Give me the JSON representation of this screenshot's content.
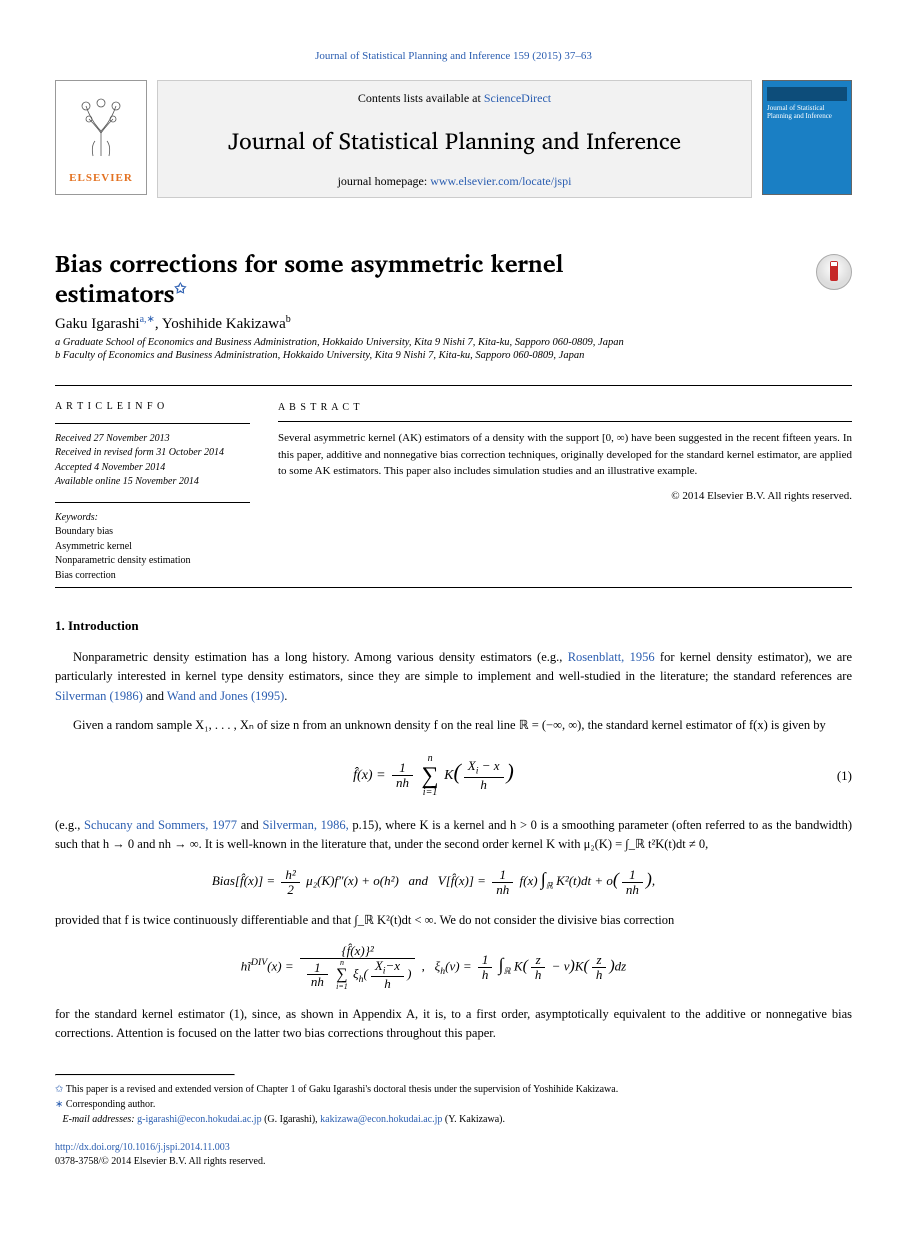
{
  "citation": "Journal of Statistical Planning and Inference 159 (2015) 37–63",
  "masthead": {
    "contents_prefix": "Contents lists available at ",
    "contents_link": "ScienceDirect",
    "journal_name": "Journal of Statistical Planning and Inference",
    "homepage_prefix": "journal homepage: ",
    "homepage_link": "www.elsevier.com/locate/jspi",
    "elsevier": "ELSEVIER",
    "cover_title": "Journal of Statistical Planning and Inference"
  },
  "article": {
    "title_line1": "Bias corrections for some asymmetric kernel",
    "title_line2": "estimators",
    "fnmark": "✩",
    "authors_a": "Gaku Igarashi",
    "authors_b": "Yoshihide Kakizawa",
    "sup_a": "a,",
    "sup_star": "∗",
    "sup_b": "b",
    "comma": ", ",
    "affiliation_a": "a Graduate School of Economics and Business Administration, Hokkaido University, Kita 9 Nishi 7, Kita-ku, Sapporo 060-0809, Japan",
    "affiliation_b": "b Faculty of Economics and Business Administration, Hokkaido University, Kita 9 Nishi 7, Kita-ku, Sapporo 060-0809, Japan"
  },
  "info": {
    "heading": "A R T I C L E   I N F O",
    "received": "Received 27 November 2013",
    "revised": "Received in revised form 31 October 2014",
    "accepted": "Accepted 4 November 2014",
    "available": "Available online 15 November 2014",
    "kw_heading": "Keywords:",
    "kw1": "Boundary bias",
    "kw2": "Asymmetric kernel",
    "kw3": "Nonparametric density estimation",
    "kw4": "Bias correction"
  },
  "abstract": {
    "heading": "A B S T R A C T",
    "text": "Several asymmetric kernel (AK) estimators of a density with the support [0, ∞) have been suggested in the recent fifteen years. In this paper, additive and nonnegative bias correction techniques, originally developed for the standard kernel estimator, are applied to some AK estimators. This paper also includes simulation studies and an illustrative example.",
    "copyright": "© 2014 Elsevier B.V. All rights reserved."
  },
  "section1": {
    "heading": "1.  Introduction",
    "para1_a": "Nonparametric density estimation has a long history. Among various density estimators (e.g., ",
    "ref1": "Rosenblatt, 1956",
    "para1_b": " for kernel density estimator), we are particularly interested in kernel type density estimators, since they are simple to implement and well-studied in the literature; the standard references are ",
    "ref2": "Silverman (1986)",
    "para1_c": " and ",
    "ref3": "Wand and Jones (1995)",
    "para1_d": ".",
    "para2_a": "Given a random sample X₁, . . . , Xₙ of size n from an unknown density f on the real line ℝ = (−∞, ∞), the standard kernel estimator of f(x) is given by",
    "eqnum": "(1)",
    "para3_a": "(e.g., ",
    "ref4": "Schucany and Sommers, 1977",
    "para3_b": " and ",
    "ref5": "Silverman, 1986,",
    "para3_c": " p.15), where K is a kernel and h > 0 is a smoothing parameter (often referred to as the bandwidth) such that h → 0 and nh → ∞. It is well-known in the literature that, under the second order kernel K with μ₂(K) = ∫_ℝ t²K(t)dt ≠ 0,",
    "para4_a": "provided that f is twice continuously differentiable and that ∫_ℝ K²(t)dt < ∞. We do not consider the divisive bias correction",
    "para5_a": "for the standard kernel estimator (1), since, as shown in Appendix A, it is, to a first order, asymptotically equivalent to the additive or nonnegative bias corrections. Attention is focused on the latter two bias corrections throughout this paper."
  },
  "footnotes": {
    "fn1_sym": "✩",
    "fn1_text": " This paper is a revised and extended version of Chapter 1 of Gaku Igarashi's doctoral thesis under the supervision of Yoshihide Kakizawa.",
    "fn2_sym": "∗",
    "fn2_text": " Corresponding author.",
    "email_label": "E-mail addresses: ",
    "email1": "g-igarashi@econ.hokudai.ac.jp",
    "email1_who": " (G. Igarashi), ",
    "email2": "kakizawa@econ.hokudai.ac.jp",
    "email2_who": " (Y. Kakizawa)."
  },
  "footer": {
    "doi": "http://dx.doi.org/10.1016/j.jspi.2014.11.003",
    "issn": "0378-3758/© 2014 Elsevier B.V. All rights reserved."
  }
}
